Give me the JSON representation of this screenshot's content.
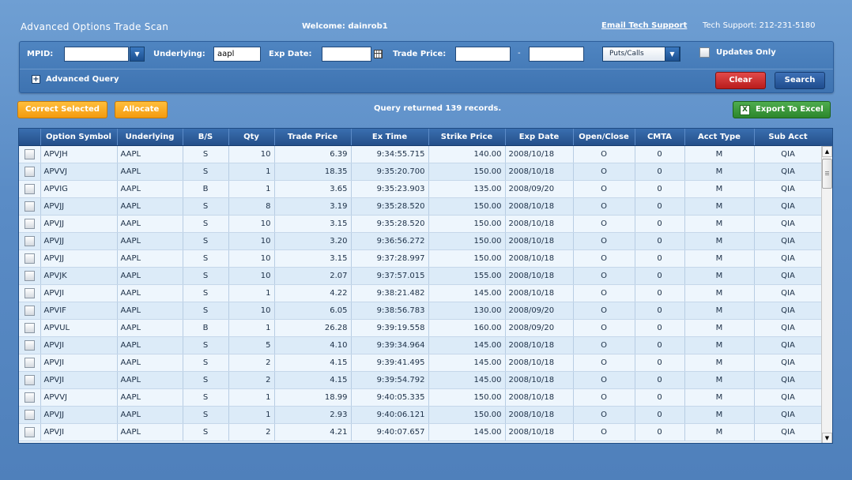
{
  "header": {
    "app_title": "Advanced Options Trade Scan",
    "welcome": "Welcome: dainrob1",
    "email_support": "Email Tech Support",
    "tech_support": "Tech Support: 212-231-5180"
  },
  "filters": {
    "mpid_label": "MPID:",
    "mpid_value": "",
    "underlying_label": "Underlying:",
    "underlying_value": "aapl",
    "exp_date_label": "Exp Date:",
    "exp_date_value": "",
    "trade_price_label": "Trade Price:",
    "trade_price_from": "",
    "range_separator": "-",
    "trade_price_to": "",
    "puts_calls_value": "Puts/Calls",
    "updates_only_label": "Updates Only",
    "updates_only_checked": false,
    "advanced_query_label": "Advanced Query",
    "clear_label": "Clear",
    "search_label": "Search"
  },
  "actions": {
    "correct_selected_label": "Correct Selected",
    "allocate_label": "Allocate",
    "query_status": "Query returned 139 records.",
    "export_label": "Export To Excel"
  },
  "grid": {
    "columns": [
      "",
      "Option Symbol",
      "Underlying",
      "B/S",
      "Qty",
      "Trade Price",
      "Ex Time",
      "Strike Price",
      "Exp Date",
      "Open/Close",
      "CMTA",
      "Acct Type",
      "Sub Acct"
    ],
    "rows": [
      [
        "APVJH",
        "AAPL",
        "S",
        "10",
        "6.39",
        "9:34:55.715",
        "140.00",
        "2008/10/18",
        "O",
        "0",
        "M",
        "QIA"
      ],
      [
        "APVVJ",
        "AAPL",
        "S",
        "1",
        "18.35",
        "9:35:20.700",
        "150.00",
        "2008/10/18",
        "O",
        "0",
        "M",
        "QIA"
      ],
      [
        "APVIG",
        "AAPL",
        "B",
        "1",
        "3.65",
        "9:35:23.903",
        "135.00",
        "2008/09/20",
        "O",
        "0",
        "M",
        "QIA"
      ],
      [
        "APVJJ",
        "AAPL",
        "S",
        "8",
        "3.19",
        "9:35:28.520",
        "150.00",
        "2008/10/18",
        "O",
        "0",
        "M",
        "QIA"
      ],
      [
        "APVJJ",
        "AAPL",
        "S",
        "10",
        "3.15",
        "9:35:28.520",
        "150.00",
        "2008/10/18",
        "O",
        "0",
        "M",
        "QIA"
      ],
      [
        "APVJJ",
        "AAPL",
        "S",
        "10",
        "3.20",
        "9:36:56.272",
        "150.00",
        "2008/10/18",
        "O",
        "0",
        "M",
        "QIA"
      ],
      [
        "APVJJ",
        "AAPL",
        "S",
        "10",
        "3.15",
        "9:37:28.997",
        "150.00",
        "2008/10/18",
        "O",
        "0",
        "M",
        "QIA"
      ],
      [
        "APVJK",
        "AAPL",
        "S",
        "10",
        "2.07",
        "9:37:57.015",
        "155.00",
        "2008/10/18",
        "O",
        "0",
        "M",
        "QIA"
      ],
      [
        "APVJI",
        "AAPL",
        "S",
        "1",
        "4.22",
        "9:38:21.482",
        "145.00",
        "2008/10/18",
        "O",
        "0",
        "M",
        "QIA"
      ],
      [
        "APVIF",
        "AAPL",
        "S",
        "10",
        "6.05",
        "9:38:56.783",
        "130.00",
        "2008/09/20",
        "O",
        "0",
        "M",
        "QIA"
      ],
      [
        "APVUL",
        "AAPL",
        "B",
        "1",
        "26.28",
        "9:39:19.558",
        "160.00",
        "2008/09/20",
        "O",
        "0",
        "M",
        "QIA"
      ],
      [
        "APVJI",
        "AAPL",
        "S",
        "5",
        "4.10",
        "9:39:34.964",
        "145.00",
        "2008/10/18",
        "O",
        "0",
        "M",
        "QIA"
      ],
      [
        "APVJI",
        "AAPL",
        "S",
        "2",
        "4.15",
        "9:39:41.495",
        "145.00",
        "2008/10/18",
        "O",
        "0",
        "M",
        "QIA"
      ],
      [
        "APVJI",
        "AAPL",
        "S",
        "2",
        "4.15",
        "9:39:54.792",
        "145.00",
        "2008/10/18",
        "O",
        "0",
        "M",
        "QIA"
      ],
      [
        "APVVJ",
        "AAPL",
        "S",
        "1",
        "18.99",
        "9:40:05.335",
        "150.00",
        "2008/10/18",
        "O",
        "0",
        "M",
        "QIA"
      ],
      [
        "APVJJ",
        "AAPL",
        "S",
        "1",
        "2.93",
        "9:40:06.121",
        "150.00",
        "2008/10/18",
        "O",
        "0",
        "M",
        "QIA"
      ],
      [
        "APVJI",
        "AAPL",
        "S",
        "2",
        "4.21",
        "9:40:07.657",
        "145.00",
        "2008/10/18",
        "O",
        "0",
        "M",
        "QIA"
      ]
    ]
  },
  "icons": {
    "dropdown": "chevron-down-icon",
    "calendar": "calendar-icon",
    "expand": "plus-icon",
    "excel": "excel-icon",
    "scroll_up": "scroll-up-icon",
    "scroll_down": "scroll-down-icon"
  },
  "colors": {
    "background": "#5a8cc6",
    "clear_button": "#c9302c",
    "search_button": "#2a5a9c",
    "orange_button": "#f7a520",
    "export_button": "#3a9a3a",
    "grid_header": "#2f5e9e"
  }
}
